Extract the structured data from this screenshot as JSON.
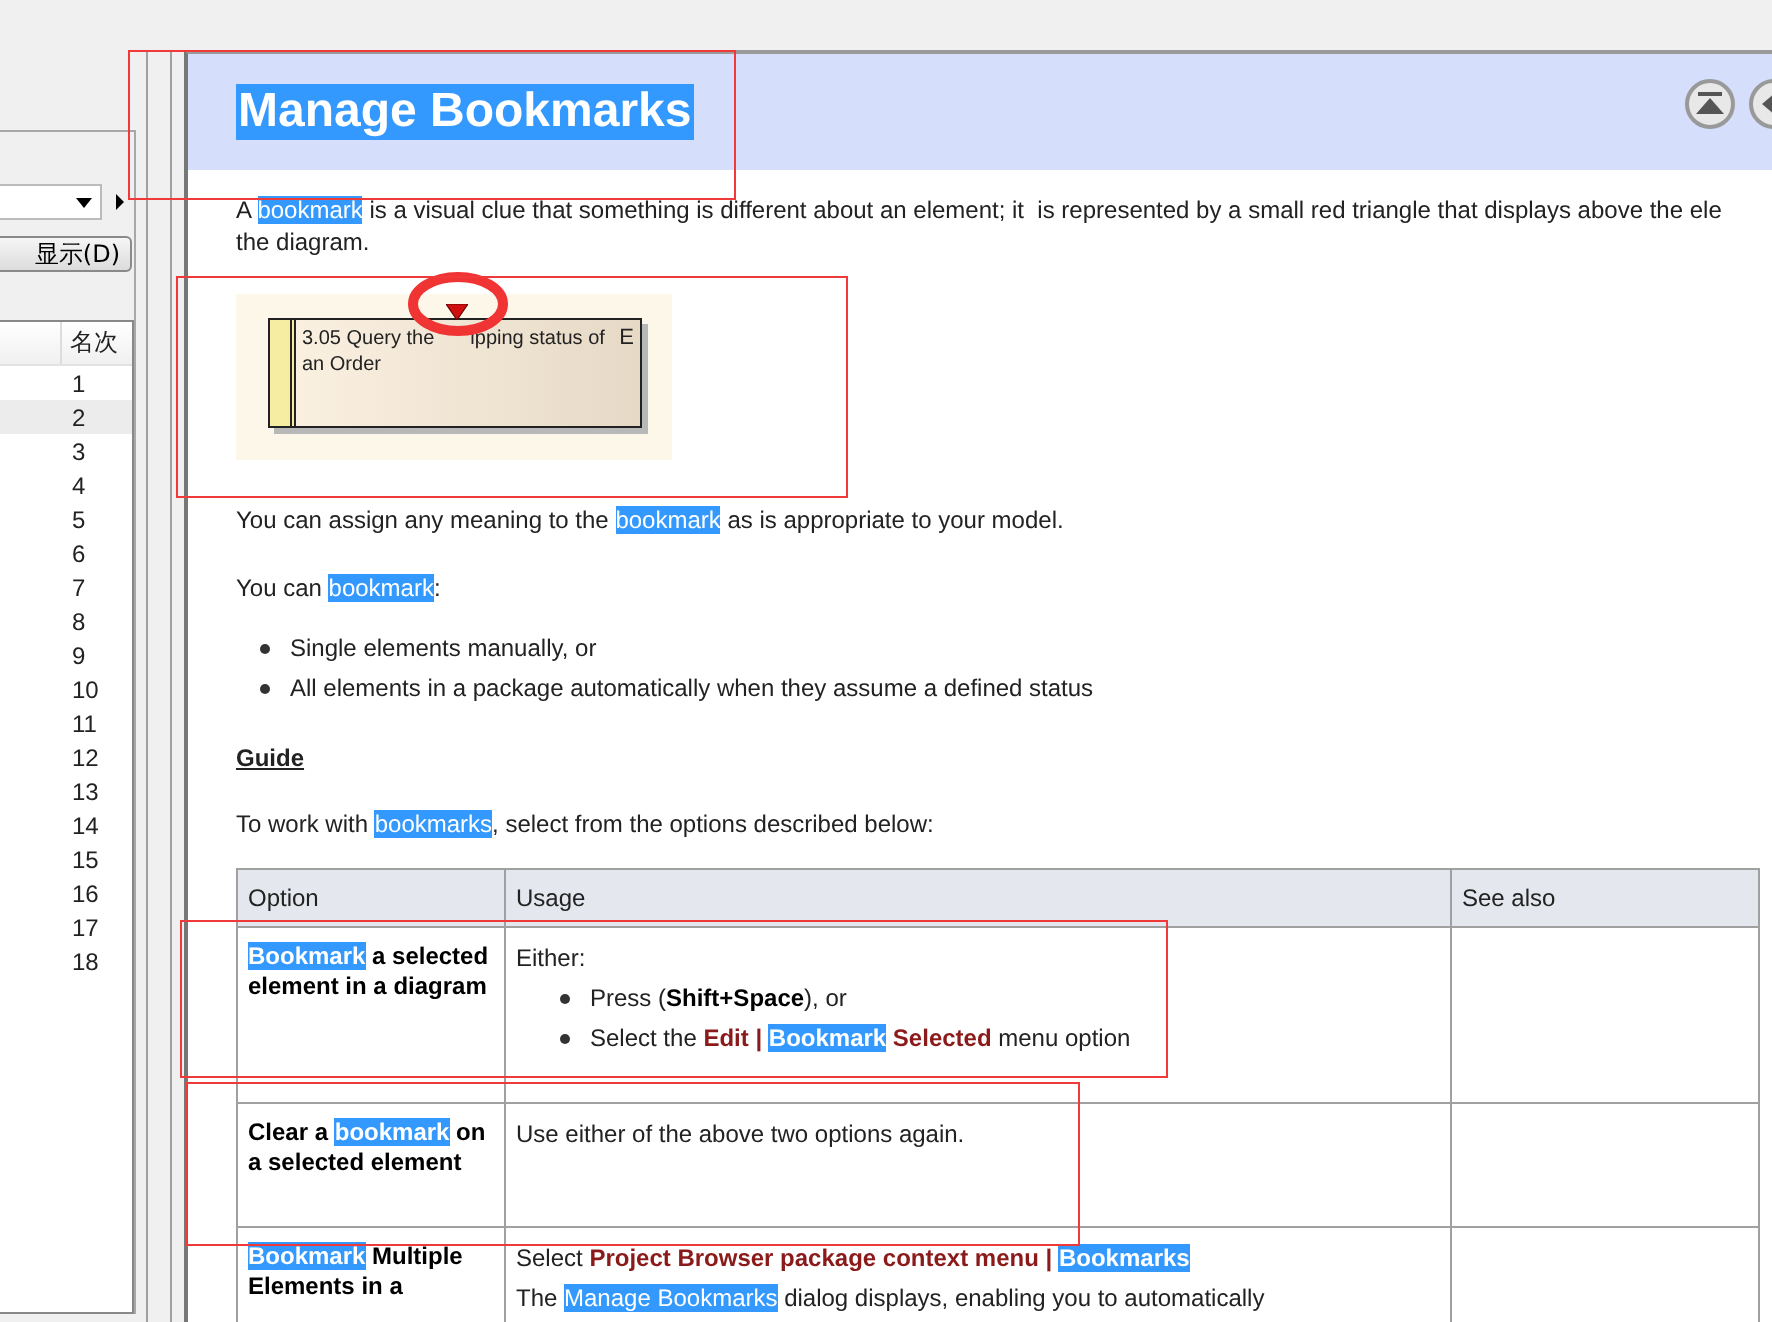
{
  "left_panel": {
    "button": "显示(D)",
    "list": {
      "column": "名次",
      "rows": [
        {
          "rank": "1",
          "selected": false
        },
        {
          "rank": "2",
          "selected": true
        },
        {
          "rank": "3",
          "selected": false
        },
        {
          "rank": "4",
          "selected": false
        },
        {
          "rank": "5",
          "selected": false
        },
        {
          "rank": "6",
          "selected": false
        },
        {
          "rank": "7",
          "selected": false
        },
        {
          "rank": "8",
          "selected": false
        },
        {
          "rank": "9",
          "selected": false
        },
        {
          "rank": "10",
          "selected": false
        },
        {
          "rank": "11",
          "selected": false
        },
        {
          "rank": "12",
          "selected": false
        },
        {
          "rank": "13",
          "selected": false
        },
        {
          "rank": "14",
          "selected": false
        },
        {
          "rank": "15",
          "selected": false
        },
        {
          "rank": "16",
          "selected": false
        },
        {
          "rank": "17",
          "selected": false
        },
        {
          "rank": "18",
          "selected": false
        }
      ]
    }
  },
  "help_page": {
    "title": {
      "text": "Manage Bookmarks",
      "highlight": true
    },
    "intro": [
      [
        {
          "text": "A ",
          "highlight": false,
          "kind": "plain"
        },
        {
          "text": "bookmark",
          "highlight": true,
          "kind": "plain"
        },
        {
          "text": " is a visual clue that something is different about an element; it  is represented by a small red triangle that displays above the ele",
          "highlight": false,
          "kind": "plain"
        }
      ],
      [
        {
          "text": "the diagram.",
          "highlight": false,
          "kind": "plain"
        }
      ]
    ],
    "diagram": {
      "text_before": "3.05 Query the",
      "text_after": "ipping status of",
      "text_line2": "an Order",
      "corner": "E"
    },
    "paragraphs": [
      [
        {
          "text": "You can assign any meaning to the ",
          "highlight": false,
          "kind": "plain"
        },
        {
          "text": "bookmark",
          "highlight": true,
          "kind": "plain"
        },
        {
          "text": " as is appropriate to your model.",
          "highlight": false,
          "kind": "plain"
        }
      ],
      [
        {
          "text": "You can ",
          "highlight": false,
          "kind": "plain"
        },
        {
          "text": "bookmark",
          "highlight": true,
          "kind": "plain"
        },
        {
          "text": ":",
          "highlight": false,
          "kind": "plain"
        }
      ]
    ],
    "bullets": [
      "Single elements manually, or",
      "All elements in a package automatically when they assume a defined status"
    ],
    "guide": "Guide",
    "lead": [
      {
        "text": "To work with ",
        "highlight": false,
        "kind": "plain"
      },
      {
        "text": "bookmarks",
        "highlight": true,
        "kind": "plain"
      },
      {
        "text": ", select from the options described below:",
        "highlight": false,
        "kind": "plain"
      }
    ],
    "table": {
      "columns": [
        "Option",
        "Usage",
        "See also"
      ],
      "rows": [
        {
          "option": [
            {
              "text": "Bookmark",
              "highlight": true,
              "kind": "bold"
            },
            {
              "text": " a selected element in a diagram",
              "highlight": false,
              "kind": "bold"
            }
          ],
          "usage": [
            {
              "kind": "line",
              "segments": [
                {
                  "text": "Either:",
                  "highlight": false,
                  "kind": "plain"
                }
              ]
            },
            {
              "kind": "bullet",
              "segments": [
                {
                  "text": "Press (",
                  "highlight": false,
                  "kind": "plain"
                },
                {
                  "text": "Shift+Space",
                  "highlight": false,
                  "kind": "bold"
                },
                {
                  "text": "), or",
                  "highlight": false,
                  "kind": "plain"
                }
              ]
            },
            {
              "kind": "bullet",
              "segments": [
                {
                  "text": "Select the ",
                  "highlight": false,
                  "kind": "plain"
                },
                {
                  "text": "Edit | ",
                  "highlight": false,
                  "kind": "menu"
                },
                {
                  "text": "Bookmark",
                  "highlight": true,
                  "kind": "menu"
                },
                {
                  "text": " Selected",
                  "highlight": false,
                  "kind": "menu"
                },
                {
                  "text": " menu option",
                  "highlight": false,
                  "kind": "plain"
                }
              ]
            }
          ]
        },
        {
          "option": [
            {
              "text": "Clear a ",
              "highlight": false,
              "kind": "bold"
            },
            {
              "text": "bookmark",
              "highlight": true,
              "kind": "bold"
            },
            {
              "text": " on a selected element",
              "highlight": false,
              "kind": "bold"
            }
          ],
          "usage": [
            {
              "kind": "line",
              "segments": [
                {
                  "text": "Use either of the above two options again.",
                  "highlight": false,
                  "kind": "plain"
                }
              ]
            }
          ]
        },
        {
          "option": [
            {
              "text": "Bookmark",
              "highlight": true,
              "kind": "bold"
            },
            {
              "text": " Multiple Elements in a",
              "highlight": false,
              "kind": "bold"
            }
          ],
          "usage": [
            {
              "kind": "line",
              "segments": [
                {
                  "text": "Select ",
                  "highlight": false,
                  "kind": "plain"
                },
                {
                  "text": "Project Browser package context menu | ",
                  "highlight": false,
                  "kind": "menu"
                },
                {
                  "text": "Bookmarks",
                  "highlight": true,
                  "kind": "menu"
                }
              ]
            },
            {
              "kind": "line",
              "segments": [
                {
                  "text": "The ",
                  "highlight": false,
                  "kind": "plain"
                },
                {
                  "text": "Manage Bookmarks",
                  "highlight": true,
                  "kind": "plain"
                },
                {
                  "text": " dialog displays, enabling you to automatically",
                  "highlight": false,
                  "kind": "plain"
                }
              ]
            }
          ]
        }
      ]
    }
  }
}
